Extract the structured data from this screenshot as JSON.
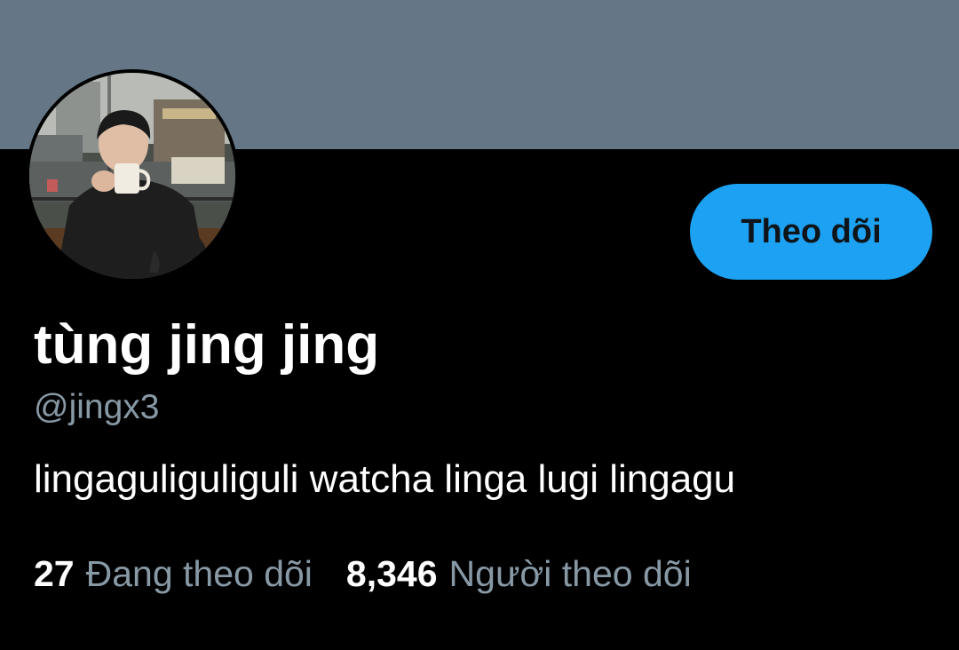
{
  "colors": {
    "banner": "#657786",
    "background": "#000000",
    "accent": "#1da1f2",
    "secondary_text": "#8899a6",
    "primary_text": "#ffffff"
  },
  "profile": {
    "display_name": "tùng jing jing",
    "handle": "@jingx3",
    "bio": "lingaguliguliguli watcha linga lugi lingagu",
    "follow_button_label": "Theo dõi",
    "avatar_icon": "avatar-photo"
  },
  "stats": {
    "following_count": "27",
    "following_label": "Đang theo dõi",
    "followers_count": "8,346",
    "followers_label": "Người theo dõi"
  }
}
